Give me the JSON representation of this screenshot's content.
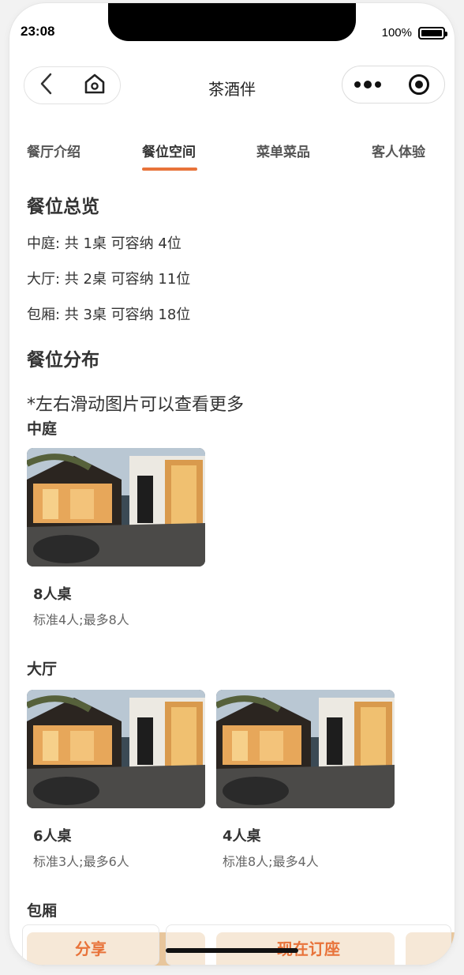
{
  "status": {
    "time": "23:08",
    "battery": "100%"
  },
  "nav": {
    "title": "茶酒伴"
  },
  "tabs": [
    {
      "label": "餐厅介绍"
    },
    {
      "label": "餐位空间"
    },
    {
      "label": "菜单菜品"
    },
    {
      "label": "客人体验"
    }
  ],
  "active_tab": "餐位空间",
  "overview": {
    "title": "餐位总览",
    "lines": [
      "中庭: 共 1桌 可容纳 4位",
      "大厅: 共 2桌 可容纳 11位",
      "包厢: 共 3桌 可容纳 18位"
    ]
  },
  "distribution": {
    "title": "餐位分布",
    "note": "*左右滑动图片可以查看更多",
    "sections": [
      {
        "name": "中庭",
        "cards": [
          {
            "title": "8人桌",
            "sub": "标准4人;最多8人"
          }
        ]
      },
      {
        "name": "大厅",
        "cards": [
          {
            "title": "6人桌",
            "sub": "标准3人;最多6人"
          },
          {
            "title": "4人桌",
            "sub": "标准8人;最多4人"
          }
        ]
      },
      {
        "name": "包厢"
      }
    ]
  },
  "bottom": {
    "share": "分享",
    "book": "现在订座"
  },
  "colors": {
    "accent": "#e8733a"
  },
  "icons": {
    "back": "back-chevron-icon",
    "home": "home-icon",
    "more": "more-dots-icon",
    "close": "close-circle-icon"
  }
}
